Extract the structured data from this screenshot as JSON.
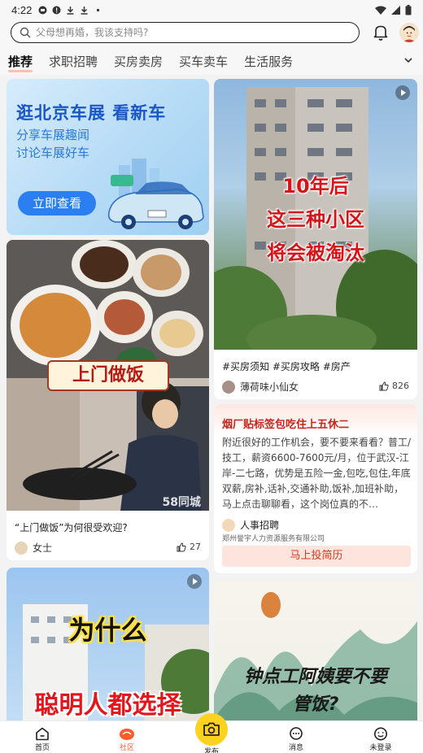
{
  "status_bar": {
    "time": "4:22"
  },
  "search": {
    "placeholder": "父母想再婚，我该支持吗?"
  },
  "tabs": [
    {
      "label": "推荐"
    },
    {
      "label": "求职招聘"
    },
    {
      "label": "买房卖房"
    },
    {
      "label": "买车卖车"
    },
    {
      "label": "生活服务"
    }
  ],
  "banner": {
    "title": "逛北京车展 看新车",
    "line1": "分享车展趣闻",
    "line2": "讨论车展好车",
    "button": "立即查看"
  },
  "post_food": {
    "overlay": "上门做饭",
    "watermark": "58同城",
    "caption": "“上门做饭”为何很受欢迎?",
    "author": "女士",
    "likes": "27"
  },
  "post_house": {
    "overlay_line1": "10年后",
    "overlay_line2": "这三种小区",
    "overlay_line3": "将会被淘汰",
    "tags": "#买房须知 #买房攻略 #房产",
    "author": "薄荷味小仙女",
    "likes": "826"
  },
  "job_card": {
    "title": "烟厂贴标签包吃住上五休二",
    "desc": "附近很好的工作机会，要不要来看看？普工/技工，薪资6600-7600元/月，位于武汉-江岸-二七路，优势是五险一金,包吃,包住,年底双薪,房补,话补,交通补助,饭补,加班补助，马上点击聊聊看，这个岗位真的不…",
    "recruiter": "人事招聘",
    "company": "郑州誉宇人力资源服务有限公司",
    "apply": "马上投简历"
  },
  "post_why": {
    "line1": "为什么",
    "line2": "聪明人都选择"
  },
  "post_meal": {
    "line1": "钟点工阿姨要不要",
    "line2": "管饭?"
  },
  "bottom_nav": {
    "home": "首页",
    "community": "社区",
    "publish": "发布",
    "messages": "消息",
    "login": "未登录"
  },
  "colors": {
    "accent": "#ff5a2a",
    "publish": "#ffd21f",
    "overlay_red": "#d5141a"
  }
}
